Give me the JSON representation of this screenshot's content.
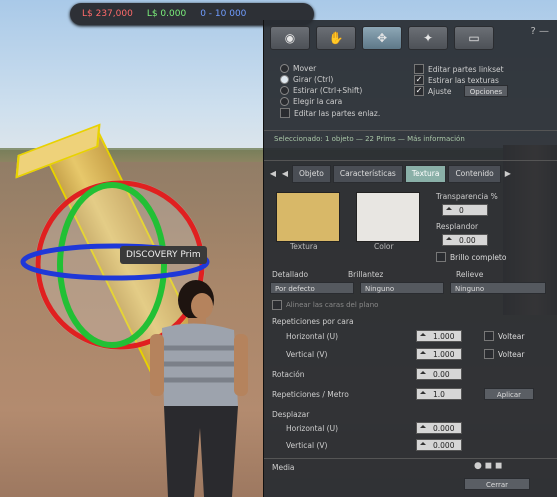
{
  "status_bar": {
    "balance": "L$ 237,000",
    "fps": "L$ 0.000",
    "extra": "0 - 10 000"
  },
  "object_tag": "DISCOVERY Prim",
  "tools": [
    {
      "icon": "camera-icon",
      "glyph": "◉"
    },
    {
      "icon": "hand-icon",
      "glyph": "✋"
    },
    {
      "icon": "move-icon",
      "glyph": "✥"
    },
    {
      "icon": "create-icon",
      "glyph": "✦"
    },
    {
      "icon": "land-icon",
      "glyph": "▭"
    }
  ],
  "window_controls": "? —",
  "options": {
    "move": "Mover",
    "color_rotate": "Girar (Ctrl)",
    "stretch": "Estirar (Ctrl+Shift)",
    "select_face": "Elegir la cara",
    "edit_linked": "Editar las partes enlaz.",
    "edit_linked_parts": "Editar partes linkset",
    "stretch_both": "Estirar las texturas",
    "snap": "Ajuste",
    "grid_button": "Opciones"
  },
  "object_info": "Seleccionado: 1 objeto — 22 Prims — Más información",
  "tabs": [
    "Objeto",
    "Características",
    "Textura",
    "Contenido"
  ],
  "active_tab": "Textura",
  "texture": {
    "texture_label": "Textura",
    "color_label": "Color",
    "transparency_label": "Transparencia %",
    "transparency": "0",
    "glow_label": "Resplandor",
    "glow": "0.00",
    "fullbright_label": "Brillo completo",
    "mapping_label": "Detallado",
    "mapping": "Por defecto",
    "shininess_label": "Brillantez",
    "shininess": "Ninguno",
    "bumpiness_label": "Relieve",
    "bumpiness": "Ninguno",
    "align_label": "Alinear las caras del plano",
    "repeats_label": "Repeticiones por cara",
    "horizontal_u": "Horizontal (U)",
    "h_value": "1.000",
    "flip_h": "Voltear",
    "vertical_v": "Vertical (V)",
    "v_value": "1.000",
    "flip_v": "Voltear",
    "rotation_label": "Rotación",
    "rotation": "0.00",
    "repeats_meter_label": "Repeticiones / Metro",
    "repeats_meter": "1.0",
    "apply_button": "Aplicar",
    "offset_label": "Desplazar",
    "offset_h_label": "Horizontal (U)",
    "offset_h": "0.000",
    "offset_v_label": "Vertical (V)",
    "offset_v": "0.000",
    "media_label": "Media",
    "close_button": "Cerrar"
  },
  "colors": {
    "texture_swatch": "#d8b868",
    "color_swatch": "#e8e6e2",
    "active_tab": "#8ab0a8"
  }
}
